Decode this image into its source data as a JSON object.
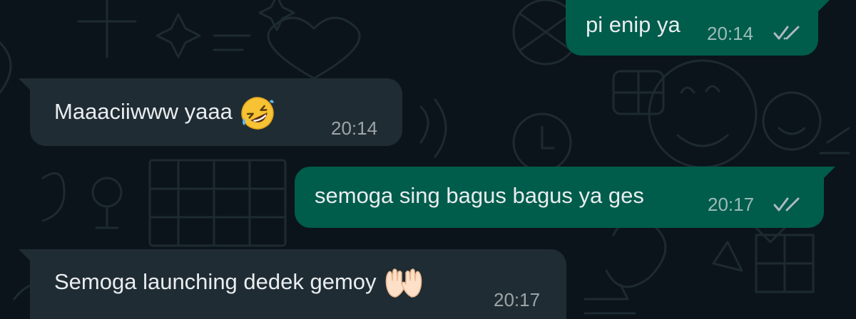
{
  "chat": {
    "messages": [
      {
        "direction": "outgoing",
        "text": "pi enip ya",
        "time": "20:14",
        "status": "read"
      },
      {
        "direction": "incoming",
        "text": "Maaaciiwww yaaa",
        "emoji": "rolling-on-floor-laughing-emoji",
        "time": "20:14"
      },
      {
        "direction": "outgoing",
        "text": "semoga sing bagus bagus ya ges",
        "time": "20:17",
        "status": "read"
      },
      {
        "direction": "incoming",
        "text": "Semoga launching dedek gemoy",
        "emoji": "raising-hands-emoji",
        "time": "20:17"
      }
    ]
  },
  "colors": {
    "background": "#0b141a",
    "outgoing_bubble": "#005c4b",
    "incoming_bubble": "#202c33",
    "text": "#e9edef",
    "read_ticks": "#aebac1"
  }
}
